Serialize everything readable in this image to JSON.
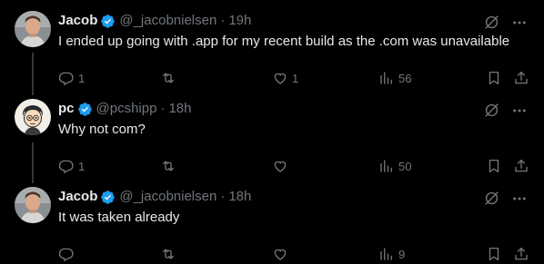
{
  "colors": {
    "background": "#000000",
    "text_primary": "#e7e9ea",
    "text_secondary": "#71767b",
    "verified_blue": "#1d9bf0",
    "thread_line": "#333639"
  },
  "tweets": [
    {
      "name": "Jacob",
      "handle": "@_jacobnielsen",
      "separator": "·",
      "time": "19h",
      "text": "I ended up going with .app for my recent build as the .com was unavailable",
      "replies": "1",
      "retweets": "",
      "likes": "1",
      "views": "56",
      "avatar": "avatar-jacob"
    },
    {
      "name": "pc",
      "handle": "@pcshipp",
      "separator": "·",
      "time": "18h",
      "text": "Why not com?",
      "replies": "1",
      "retweets": "",
      "likes": "",
      "views": "50",
      "avatar": "avatar-pc-cartoon"
    },
    {
      "name": "Jacob",
      "handle": "@_jacobnielsen",
      "separator": "·",
      "time": "18h",
      "text": "It was taken already",
      "replies": "",
      "retweets": "",
      "likes": "",
      "views": "9",
      "avatar": "avatar-jacob"
    }
  ],
  "icons": [
    "verified-badge-icon",
    "grok-icon",
    "more-icon",
    "reply-icon",
    "retweet-icon",
    "like-icon",
    "views-icon",
    "bookmark-icon",
    "share-icon"
  ]
}
